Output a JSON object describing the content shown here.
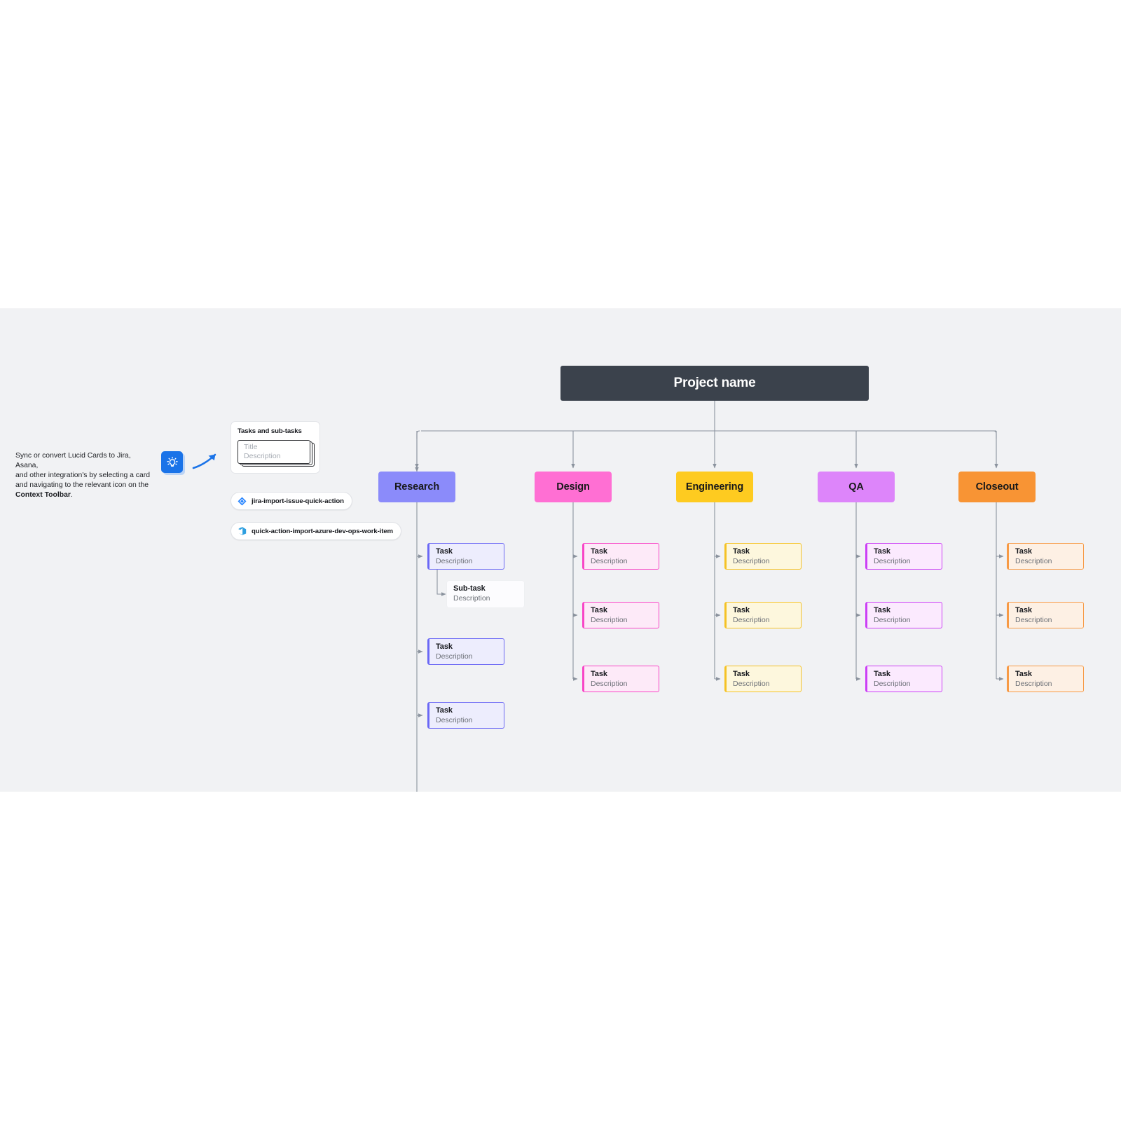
{
  "canvas": {
    "background": "#f1f2f4"
  },
  "root": {
    "label": "Project name",
    "color": "#3b424c",
    "text_color": "#ffffff"
  },
  "annotation": {
    "icon": "lightbulb-icon",
    "icon_color": "#1a73e8",
    "arrow": "curved-arrow-icon",
    "line1": "Sync or convert Lucid Cards to Jira, Asana,",
    "line2": "and other integration's by selecting a card",
    "line3": "and navigating to the relevant icon on the",
    "line4_bold": "Context Toolbar",
    "line4_tail": "."
  },
  "legend": {
    "title": "Tasks and sub-tasks",
    "placeholder_title": "Title",
    "placeholder_description": "Description"
  },
  "quick_actions": [
    {
      "id": "jira",
      "icon": "jira-diamond-icon",
      "icon_color": "#2684ff",
      "label": "jira-import-issue-quick-action"
    },
    {
      "id": "azure",
      "icon": "azure-devops-icon",
      "icon_color": "#2e9fe0",
      "label": "quick-action-import-azure-dev-ops-work-item"
    }
  ],
  "chart_data": {
    "type": "diagram",
    "title": "Project name",
    "diagram_kind": "org-chart / work-breakdown structure",
    "columns": [
      {
        "name": "Research",
        "fill": "#8b8bfa",
        "card_fill": "#ededfd",
        "card_border": "#6b68f5",
        "tasks": [
          {
            "title": "Task",
            "description": "Description",
            "subtasks": [
              {
                "title": "Sub-task",
                "description": "Description"
              }
            ]
          },
          {
            "title": "Task",
            "description": "Description",
            "subtasks": []
          },
          {
            "title": "Task",
            "description": "Description",
            "subtasks": []
          }
        ]
      },
      {
        "name": "Design",
        "fill": "#ff6fd3",
        "card_fill": "#fdeaf8",
        "card_border": "#f845c6",
        "tasks": [
          {
            "title": "Task",
            "description": "Description",
            "subtasks": []
          },
          {
            "title": "Task",
            "description": "Description",
            "subtasks": []
          },
          {
            "title": "Task",
            "description": "Description",
            "subtasks": []
          }
        ]
      },
      {
        "name": "Engineering",
        "fill": "#fecb20",
        "card_fill": "#fdf7dd",
        "card_border": "#f5c224",
        "tasks": [
          {
            "title": "Task",
            "description": "Description",
            "subtasks": []
          },
          {
            "title": "Task",
            "description": "Description",
            "subtasks": []
          },
          {
            "title": "Task",
            "description": "Description",
            "subtasks": []
          }
        ]
      },
      {
        "name": "QA",
        "fill": "#dd85fa",
        "card_fill": "#fbeafe",
        "card_border": "#cb3ff5",
        "tasks": [
          {
            "title": "Task",
            "description": "Description",
            "subtasks": []
          },
          {
            "title": "Task",
            "description": "Description",
            "subtasks": []
          },
          {
            "title": "Task",
            "description": "Description",
            "subtasks": []
          }
        ]
      },
      {
        "name": "Closeout",
        "fill": "#f89434",
        "card_fill": "#fdf0e4",
        "card_border": "#f79a45",
        "tasks": [
          {
            "title": "Task",
            "description": "Description",
            "subtasks": []
          },
          {
            "title": "Task",
            "description": "Description",
            "subtasks": []
          },
          {
            "title": "Task",
            "description": "Description",
            "subtasks": []
          }
        ]
      }
    ],
    "connector_color": "#8b939e"
  }
}
